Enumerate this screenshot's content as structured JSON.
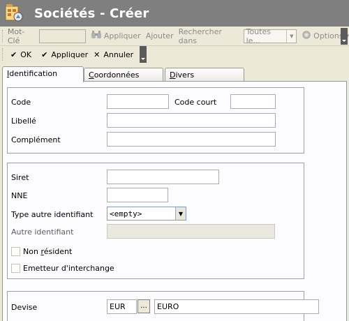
{
  "window": {
    "title": "Sociétés - Créer"
  },
  "toolbar1": {
    "keyword_label": "Mot-Clé",
    "keyword_value": "",
    "apply_label": "Appliquer",
    "add_label": "Ajouter",
    "search_in_label": "Rechercher dans",
    "search_in_value": "Toutes le...",
    "options_label": "Options"
  },
  "toolbar2": {
    "ok_label": "OK",
    "apply_label": "Appliquer",
    "cancel_label": "Annuler"
  },
  "tabs": [
    {
      "first": "I",
      "rest": "dentification"
    },
    {
      "first": "C",
      "rest": "oordonnées"
    },
    {
      "first": "D",
      "rest": "ivers"
    }
  ],
  "form": {
    "code_label": "Code",
    "code_value": "",
    "short_code_label": "Code court",
    "short_code_value": "",
    "label_label": "Libellé",
    "label_value": "",
    "complement_label": "Complément",
    "complement_value": "",
    "siret_label": "Siret",
    "siret_value": "",
    "nne_label": "NNE",
    "nne_value": "",
    "other_id_type_label": "Type autre identifiant",
    "other_id_type_value": "<empty>",
    "other_id_label": "Autre identifiant",
    "other_id_value": "",
    "non_resident_pre": "Non ",
    "non_resident_accel": "r",
    "non_resident_post": "ésident",
    "interchange_label": "Emetteur d'interchange",
    "currency_label": "Devise",
    "currency_code": "EUR",
    "currency_browse": "...",
    "currency_name": "EURO"
  }
}
